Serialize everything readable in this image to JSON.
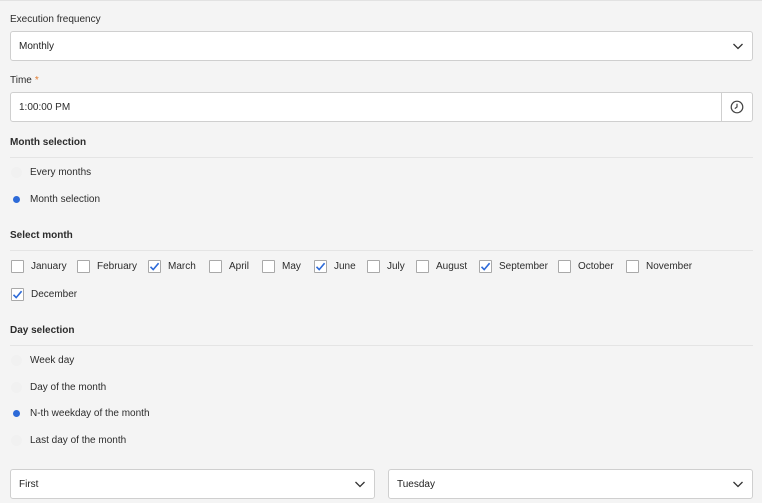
{
  "execution": {
    "label": "Execution frequency",
    "value": "Monthly"
  },
  "time": {
    "label": "Time",
    "required_marker": "*",
    "value": "1:00:00 PM"
  },
  "month_section": {
    "title": "Month selection",
    "options": [
      {
        "label": "Every months",
        "selected": false
      },
      {
        "label": "Month selection",
        "selected": true
      }
    ]
  },
  "select_month": {
    "title": "Select month",
    "months": [
      {
        "label": "January",
        "checked": false
      },
      {
        "label": "February",
        "checked": false
      },
      {
        "label": "March",
        "checked": true
      },
      {
        "label": "April",
        "checked": false
      },
      {
        "label": "May",
        "checked": false
      },
      {
        "label": "June",
        "checked": true
      },
      {
        "label": "July",
        "checked": false
      },
      {
        "label": "August",
        "checked": false
      },
      {
        "label": "September",
        "checked": true
      },
      {
        "label": "October",
        "checked": false
      },
      {
        "label": "November",
        "checked": false
      },
      {
        "label": "December",
        "checked": true
      }
    ]
  },
  "day_section": {
    "title": "Day selection",
    "options": [
      {
        "label": "Week day",
        "selected": false
      },
      {
        "label": "Day of the month",
        "selected": false
      },
      {
        "label": "N-th weekday of the month",
        "selected": true
      },
      {
        "label": "Last day of the month",
        "selected": false
      }
    ]
  },
  "nth_select": {
    "value": "First"
  },
  "weekday_select": {
    "value": "Tuesday"
  },
  "colors": {
    "accent": "#2d6ad8",
    "required": "#e07a2f"
  }
}
